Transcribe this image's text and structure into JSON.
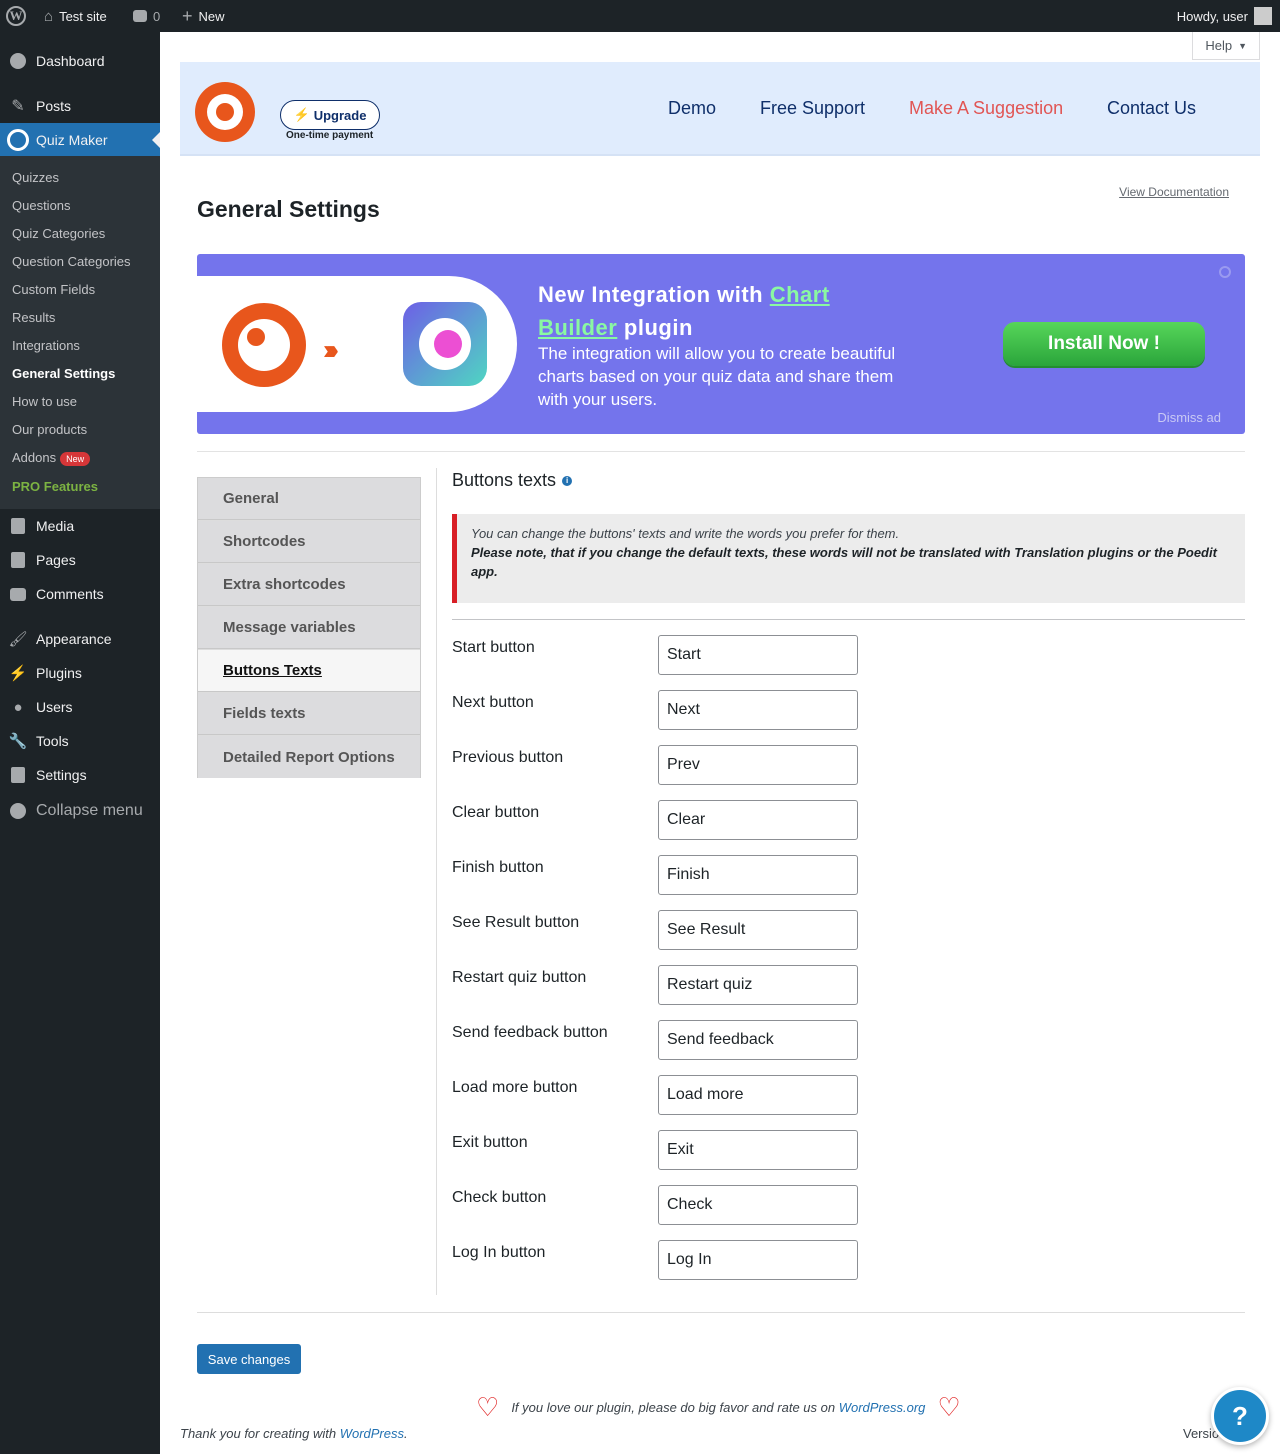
{
  "adminbar": {
    "site_name": "Test site",
    "comments_count": "0",
    "new_label": "New",
    "greeting": "Howdy, user"
  },
  "sidebar": {
    "items_top": [
      {
        "label": "Dashboard",
        "icon": "dashboard-icon"
      },
      {
        "label": "Posts",
        "icon": "pin-icon"
      },
      {
        "label": "Quiz Maker",
        "icon": "quiz-maker-icon"
      }
    ],
    "submenu": [
      {
        "label": "Quizzes"
      },
      {
        "label": "Questions"
      },
      {
        "label": "Quiz Categories"
      },
      {
        "label": "Question Categories"
      },
      {
        "label": "Custom Fields"
      },
      {
        "label": "Results"
      },
      {
        "label": "Integrations"
      },
      {
        "label": "General Settings"
      },
      {
        "label": "How to use"
      },
      {
        "label": "Our products"
      },
      {
        "label": "Addons",
        "badge": "New"
      },
      {
        "label": "PRO Features"
      }
    ],
    "items_bottom": [
      {
        "label": "Media",
        "icon": "media-icon"
      },
      {
        "label": "Pages",
        "icon": "pages-icon"
      },
      {
        "label": "Comments",
        "icon": "comments-icon"
      },
      {
        "label": "Appearance",
        "icon": "brush-icon"
      },
      {
        "label": "Plugins",
        "icon": "plug-icon"
      },
      {
        "label": "Users",
        "icon": "user-icon"
      },
      {
        "label": "Tools",
        "icon": "wrench-icon"
      },
      {
        "label": "Settings",
        "icon": "settings-icon"
      },
      {
        "label": "Collapse menu",
        "icon": "collapse-icon"
      }
    ]
  },
  "help_tab": "Help",
  "topbanner": {
    "upgrade": "Upgrade",
    "one_time": "One-time payment",
    "links": [
      "Demo",
      "Free Support",
      "Make A Suggestion",
      "Contact Us"
    ]
  },
  "page": {
    "title": "General Settings",
    "view_doc": "View Documentation"
  },
  "ad": {
    "title_pre": "New Integration with ",
    "title_link": "Chart Builder",
    "title_post": " plugin",
    "text": "The integration will allow you to create beautiful charts based on your quiz data and share them with your users.",
    "install": "Install Now !",
    "dismiss": "Dismiss ad"
  },
  "tabs": [
    "General",
    "Shortcodes",
    "Extra shortcodes",
    "Message variables",
    "Buttons Texts",
    "Fields texts",
    "Detailed Report Options"
  ],
  "section": {
    "title": "Buttons texts",
    "notice_line1": "You can change the buttons' texts and write the words you prefer for them.",
    "notice_line2": "Please note, that if you change the default texts, these words will not be translated with Translation plugins or the Poedit app."
  },
  "fields": [
    {
      "label": "Start button",
      "value": "Start"
    },
    {
      "label": "Next button",
      "value": "Next"
    },
    {
      "label": "Previous button",
      "value": "Prev"
    },
    {
      "label": "Clear button",
      "value": "Clear"
    },
    {
      "label": "Finish button",
      "value": "Finish"
    },
    {
      "label": "See Result button",
      "value": "See Result"
    },
    {
      "label": "Restart quiz button",
      "value": "Restart quiz"
    },
    {
      "label": "Send feedback button",
      "value": "Send feedback"
    },
    {
      "label": "Load more button",
      "value": "Load more"
    },
    {
      "label": "Exit button",
      "value": "Exit"
    },
    {
      "label": "Check button",
      "value": "Check"
    },
    {
      "label": "Log In button",
      "value": "Log In"
    }
  ],
  "save": "Save changes",
  "love": {
    "text": "If you love our plugin, please do big favor and rate us on ",
    "link": "WordPress.org"
  },
  "footer": {
    "left_text": "Thank you for creating with ",
    "left_link": "WordPress",
    "left_end": ".",
    "right": "Versio"
  },
  "help_fab": "?",
  "colors": {
    "admin_dark": "#1d2327",
    "wp_blue": "#2271b1",
    "quiz_orange": "#e8561c",
    "ad_purple": "#7474ec",
    "install_green": "#2aa53b",
    "suggestion_red": "#e15554"
  }
}
